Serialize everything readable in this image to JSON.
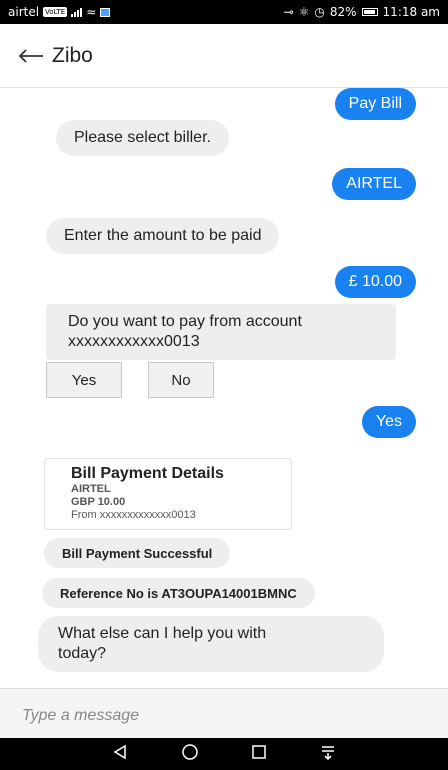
{
  "status": {
    "carrier": "airtel",
    "volte": "VoLTE",
    "battery": "82%",
    "time": "11:18 am"
  },
  "header": {
    "title": "Zibo"
  },
  "messages": {
    "pay_bill": "Pay Bill",
    "select_biller": "Please select biller.",
    "airtel": "AIRTEL",
    "enter_amount": "Enter the amount to be paid",
    "amount": "£ 10.00",
    "account_question_line1": "Do you want to pay from account",
    "account_question_line2": "xxxxxxxxxxxx0013",
    "yes_option": "Yes",
    "no_option": "No",
    "user_yes": "Yes",
    "card": {
      "title": "Bill Payment Details",
      "biller": "AIRTEL",
      "amount": "GBP 10.00",
      "from": "From xxxxxxxxxxxxx0013"
    },
    "success": "Bill Payment Successful",
    "reference": "Reference No is AT3OUPA14001BMNC",
    "help_line1": "What else can I help you with",
    "help_line2": "today?"
  },
  "input": {
    "placeholder": "Type a message"
  },
  "colors": {
    "accent": "#1a82f0",
    "bot_bubble": "#eeeeee"
  }
}
